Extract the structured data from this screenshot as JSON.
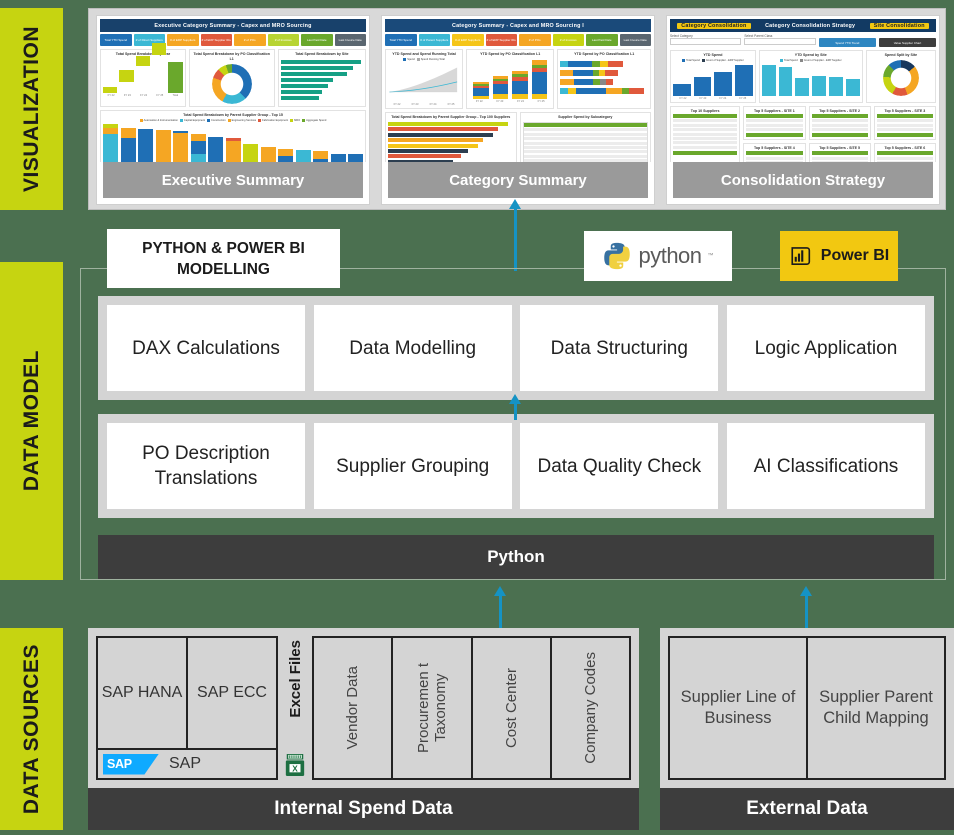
{
  "bands": {
    "visualization": "VISUALIZATION",
    "data_model": "DATA MODEL",
    "data_sources": "DATA SOURCES"
  },
  "visualization": {
    "dashboards": [
      {
        "caption": "Executive Summary",
        "title": "Executive Category Summary - Capex and MRO Sourcing",
        "chips": [
          "Total YTD Spend",
          "# of Direct Suppliers",
          "# of ERP Suppliers",
          "# of ERP Supplier IDs",
          "# of POs",
          "# of Invoices",
          "Last Paid Date",
          "Last Invoice Date"
        ],
        "panels": [
          "Total Spend Breakdown by Year",
          "Total Spend Breakdown by PO Classification L1",
          "Total Spend Breakdown by Site",
          "Total Spend Breakdown by Parent Supplier Group - Top 15"
        ],
        "legend": [
          "Automation & Instrumentation",
          "Capital Equipment",
          "Construction",
          "Engineering Services",
          "Fabrication Equipment",
          "MRO",
          "Aggregate Spend"
        ],
        "axis_years": [
          "FY 22",
          "FY 23",
          "FY 24",
          "FY 25",
          "Total"
        ]
      },
      {
        "caption": "Category Summary",
        "title": "Category Summary - Capex and MRO Sourcing I",
        "chips": [
          "Total YTD Spend",
          "# of Parent Suppliers",
          "# of ERP Suppliers",
          "# of ERP Supplier IDs",
          "# of POs",
          "# of Invoices",
          "Last Paid Date",
          "Last Invoice Date"
        ],
        "panels": [
          "YTD Spend and Spend Running Total",
          "YTD Spend by PO Classification L1",
          "YTD Spend by PO Classification L1",
          "Total Spend Breakdown by Parent Supplier Group - Top 100 Suppliers",
          "Supplier Spend by Subcategory"
        ],
        "legend": [
          "Spend",
          "Spend Running Total"
        ],
        "table_headers": [
          "Parent Supplier Group",
          "FY 22",
          "FY 23",
          "FY 24",
          "FY 25"
        ],
        "axis_years": [
          "FY 22",
          "FY 23",
          "FY 24",
          "FY 25"
        ]
      },
      {
        "caption": "Consolidation Strategy",
        "title": "Category Consolidation Strategy",
        "pill_left": "Category Consolidation",
        "pill_right": "Site Consolidation",
        "filters": [
          "Select Category",
          "Select Parent Class"
        ],
        "buttons": [
          "Spend YTD Trend",
          "Value Supplier Chart"
        ],
        "panels": [
          "YTD Spend",
          "YTD Spend by Site",
          "Spend Split by Site"
        ],
        "legend": [
          "Total Spend",
          "Count of Supplier - ERP Supplier"
        ],
        "tables": [
          "Top 10 Suppliers",
          "Top 5 Suppliers - SITE 1",
          "Top 5 Suppliers - SITE 2",
          "Top 5 Suppliers - SITE 3",
          "Top 5 Suppliers - SITE 4",
          "Top 5 Suppliers - SITE 5",
          "Top 5 Suppliers - SITE 6"
        ],
        "table_columns": [
          "ERP Supplier Name",
          "ID",
          "Spend"
        ],
        "axis_years": [
          "FY 22",
          "FY 23",
          "FY 24",
          "FY 25"
        ]
      }
    ]
  },
  "modelling": {
    "header_label": "PYTHON & POWER  BI MODELLING",
    "python_logo_text": "python",
    "python_tm": "™",
    "powerbi_logo_text": "Power BI",
    "top_row": [
      "DAX Calculations",
      "Data Modelling",
      "Data Structuring",
      "Logic Application"
    ],
    "bottom_row": [
      "PO Description Translations",
      "Supplier Grouping",
      "Data Quality Check",
      "AI Classifications"
    ],
    "engine_bar": "Python"
  },
  "data_sources": {
    "internal": {
      "caption": "Internal Spend Data",
      "sap_cells": [
        "SAP HANA",
        "SAP ECC"
      ],
      "sap_badge": "SAP",
      "sap_word": "SAP",
      "excel_label": "Excel Files",
      "excel_cells": [
        "Vendor Data",
        "Procuremen t Taxonomy",
        "Cost Center",
        "Company Codes"
      ]
    },
    "external": {
      "caption": "External Data",
      "cells": [
        "Supplier Line of Business",
        "Supplier Parent Child Mapping"
      ]
    }
  },
  "colors": {
    "band_green": "#C6D411",
    "background_green": "#4B7050",
    "arrow_blue": "#1593C4",
    "dark_bar": "#3D3D3D",
    "powerbi_yellow": "#F2C811",
    "sap_blue": "#0FAAFF",
    "caption_gray": "#9A9A9A"
  },
  "icons": {
    "python": "python-logo-icon",
    "powerbi": "powerbi-logo-icon",
    "sap": "sap-logo-icon",
    "excel": "excel-file-icon",
    "arrow_up": "arrow-up-icon"
  }
}
